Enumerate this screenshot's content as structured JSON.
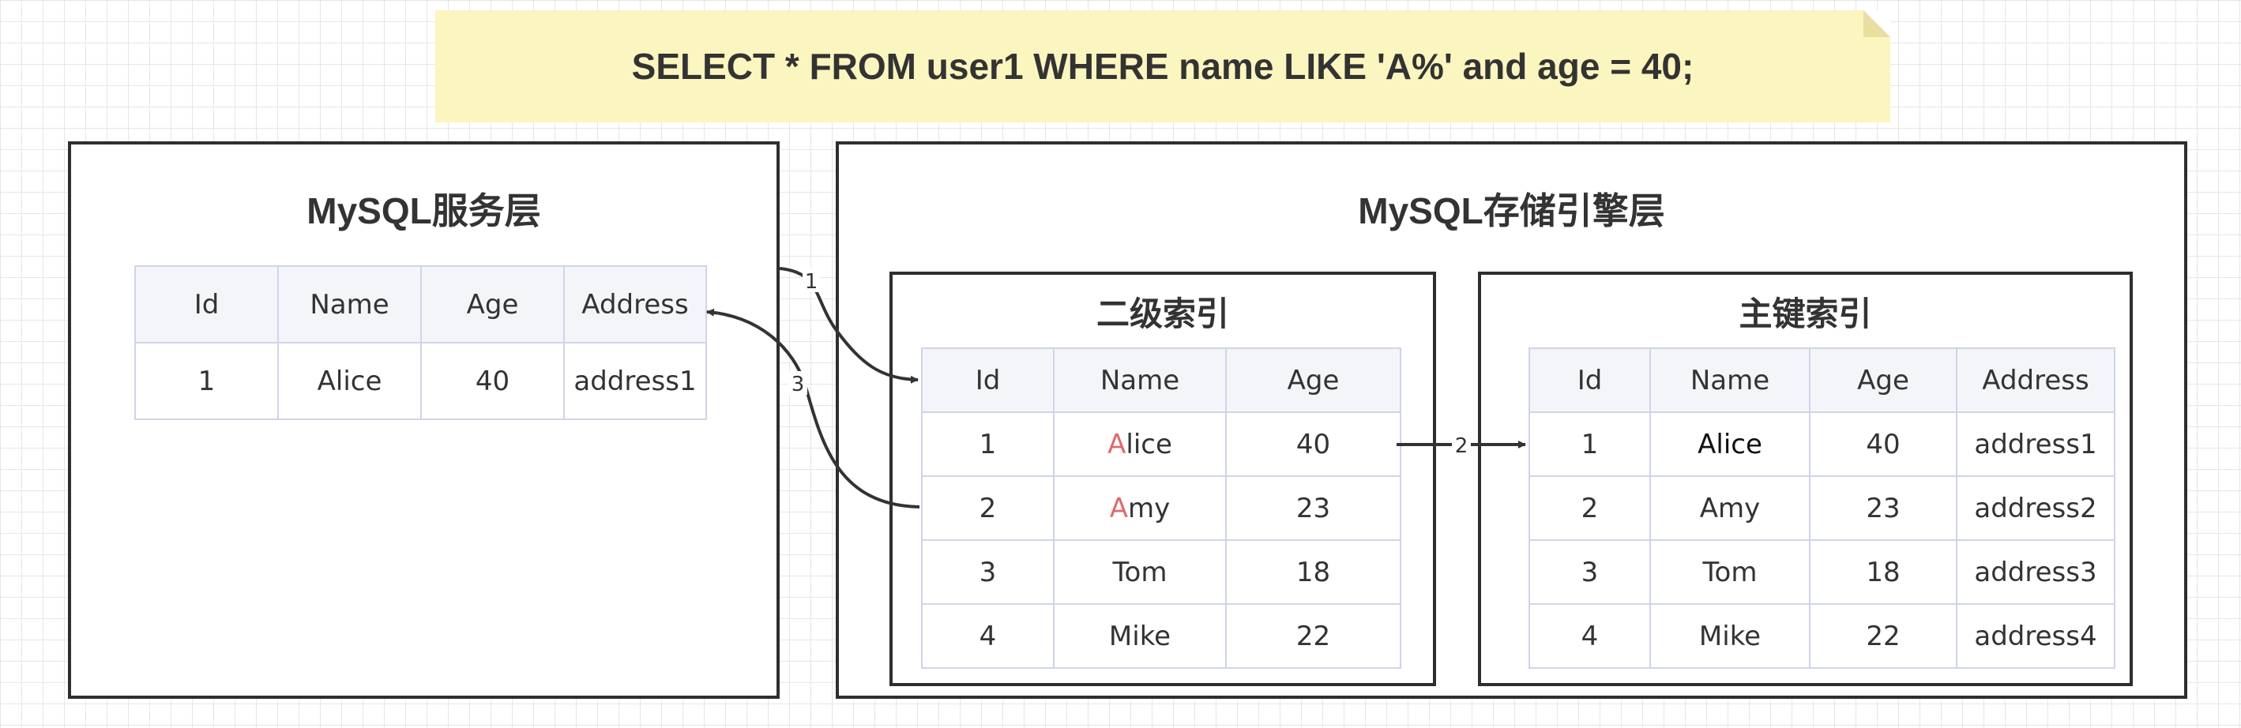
{
  "query": "SELECT * FROM user1 WHERE name LIKE 'A%' and age = 40;",
  "server_layer": {
    "title": "MySQL服务层",
    "headers": [
      "Id",
      "Name",
      "Age",
      "Address"
    ],
    "rows": [
      [
        "1",
        "Alice",
        "40",
        "address1"
      ]
    ]
  },
  "storage_layer": {
    "title": "MySQL存储引擎层",
    "secondary_index": {
      "title": "二级索引",
      "headers": [
        "Id",
        "Name",
        "Age"
      ],
      "rows": [
        {
          "id": "1",
          "name_prefix": "A",
          "name_rest": "lice",
          "age": "40"
        },
        {
          "id": "2",
          "name_prefix": "A",
          "name_rest": "my",
          "age": "23"
        },
        {
          "id": "3",
          "name": "Tom",
          "age": "18"
        },
        {
          "id": "4",
          "name": "Mike",
          "age": "22"
        }
      ]
    },
    "primary_index": {
      "title": "主键索引",
      "headers": [
        "Id",
        "Name",
        "Age",
        "Address"
      ],
      "rows": [
        [
          "1",
          "Alice",
          "40",
          "address1"
        ],
        [
          "2",
          "Amy",
          "23",
          "address2"
        ],
        [
          "3",
          "Tom",
          "18",
          "address3"
        ],
        [
          "4",
          "Mike",
          "22",
          "address4"
        ]
      ]
    }
  },
  "arrows": [
    {
      "label": "1"
    },
    {
      "label": "2"
    },
    {
      "label": "3"
    }
  ],
  "colors": {
    "note_bg": "#fbf5bf",
    "header_bg": "#f4f5f9",
    "cell_border": "#cfd4ea",
    "highlight": "#e06a6a",
    "panel_border": "#2e2e2e"
  }
}
